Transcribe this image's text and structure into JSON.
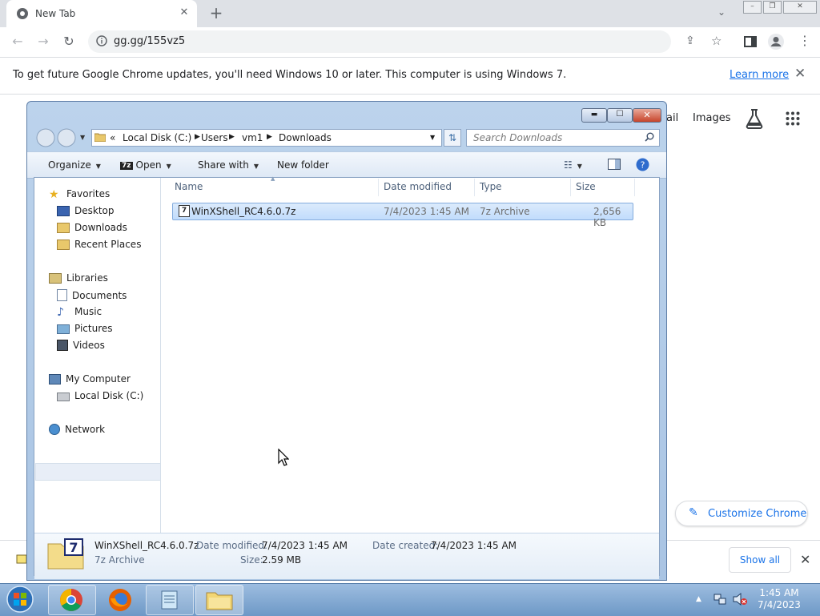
{
  "browser": {
    "tab_title": "New Tab",
    "url": "gg.gg/155vz5",
    "infobar_message": "To get future Google Chrome updates, you'll need Windows 10 or later. This computer is using Windows 7.",
    "learn_more": "Learn more",
    "ntp_links": {
      "gmail_partial": "ail",
      "images": "Images"
    },
    "customize_label": "Customize Chrome",
    "show_all_label": "Show all"
  },
  "explorer": {
    "breadcrumb": [
      "Local Disk (C:)",
      "Users",
      "vm1",
      "Downloads"
    ],
    "search_placeholder": "Search Downloads",
    "commands": {
      "organize": "Organize",
      "open": "Open",
      "share_with": "Share with",
      "new_folder": "New folder"
    },
    "nav": {
      "favorites": "Favorites",
      "desktop": "Desktop",
      "downloads": "Downloads",
      "recent_places": "Recent Places",
      "libraries": "Libraries",
      "documents": "Documents",
      "music": "Music",
      "pictures": "Pictures",
      "videos": "Videos",
      "my_computer": "My Computer",
      "local_disk": "Local Disk (C:)",
      "network": "Network"
    },
    "columns": {
      "name": "Name",
      "date_modified": "Date modified",
      "type": "Type",
      "size": "Size"
    },
    "files": [
      {
        "name": "WinXShell_RC4.6.0.7z",
        "date_modified": "7/4/2023 1:45 AM",
        "type": "7z Archive",
        "size": "2,656 KB"
      }
    ],
    "details": {
      "name": "WinXShell_RC4.6.0.7z",
      "type": "7z Archive",
      "date_modified_label": "Date modified:",
      "date_modified": "7/4/2023 1:45 AM",
      "date_created_label": "Date created:",
      "date_created": "7/4/2023 1:45 AM",
      "size_label": "Size:",
      "size": "2.59 MB"
    }
  },
  "taskbar": {
    "time": "1:45 AM",
    "date": "7/4/2023"
  },
  "colors": {
    "chrome_blue": "#1a73e8",
    "explorer_frame": "#a9c4e3",
    "selection": "#c1dcfc",
    "taskbar": "#6d98c6"
  }
}
